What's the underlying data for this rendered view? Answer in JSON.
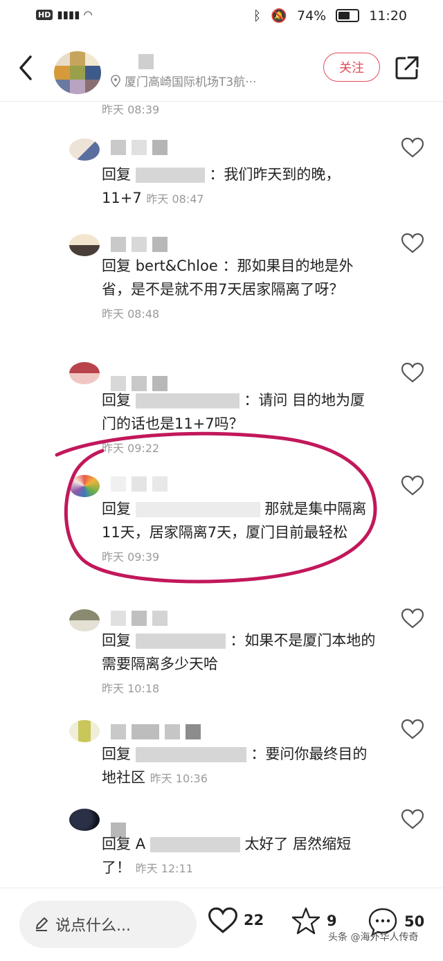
{
  "status_bar": {
    "left_text": "HD 1 4G",
    "battery": "74%",
    "battery_level": 0.74,
    "time": "11:20"
  },
  "header": {
    "location": "厦门高崎国际机场T3航···",
    "follow_label": "关注"
  },
  "comments": [
    {
      "time": "昨天 08:39"
    },
    {
      "reply_prefix": "回复",
      "text": "：我们昨天到的晚，11+7",
      "time": "昨天 08:47"
    },
    {
      "reply_prefix": "回复",
      "reply_target": "bert&Chloe",
      "text": "：那如果目的地是外省，是不是就不用7天居家隔离了呀？",
      "time": "昨天 08:48"
    },
    {
      "reply_prefix": "回复",
      "text": "：请问 目的地为厦门的话也是11+7吗？",
      "time": "昨天 09:22"
    },
    {
      "reply_prefix": "回复",
      "text": "那就是集中隔离11天，居家隔离7天，厦门目前最轻松",
      "time": "昨天 09:39"
    },
    {
      "reply_prefix": "回复",
      "text": "：如果不是厦门本地的需要隔离多少天哈",
      "time": "昨天 10:18"
    },
    {
      "reply_prefix": "回复",
      "text": "：要问你最终目的地社区",
      "time": "昨天 10:36"
    },
    {
      "reply_prefix": "回复",
      "reply_target": "A",
      "text": "太好了 居然缩短了！",
      "time": "昨天 12:11"
    }
  ],
  "bottom_bar": {
    "input_placeholder": "说点什么...",
    "likes": "22",
    "stars": "9",
    "comments": "50",
    "watermark": "头条 @海外华人传奇"
  },
  "colors": {
    "follow": "#e04a5a",
    "annotation_circle": "#c2185b"
  }
}
